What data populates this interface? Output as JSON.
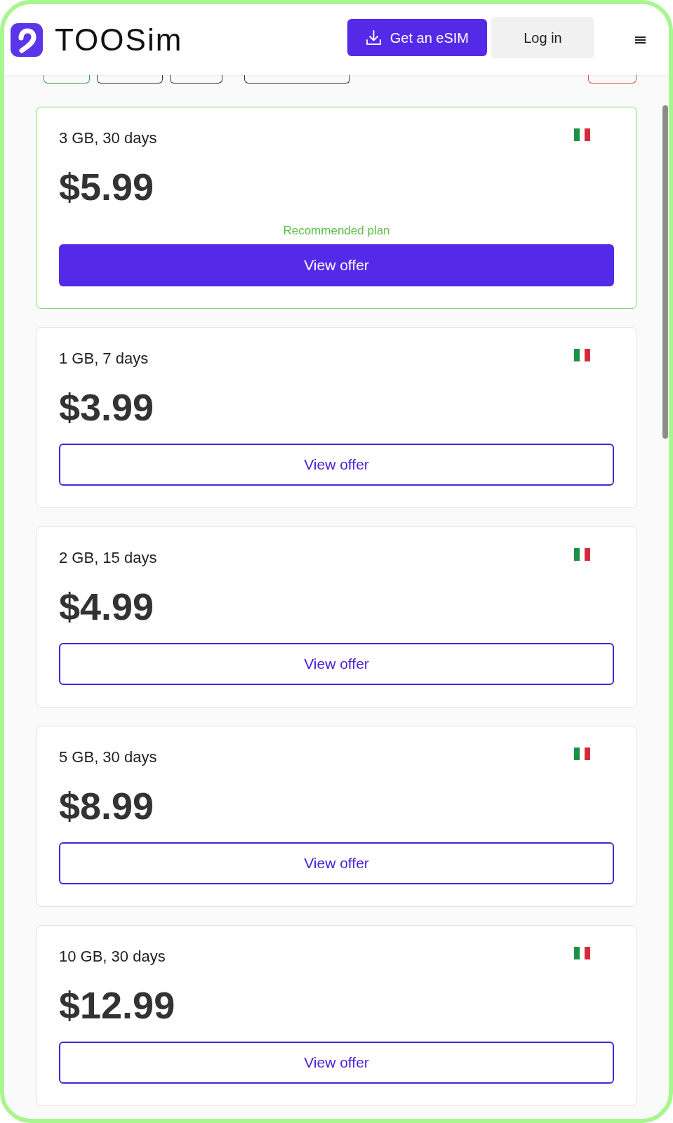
{
  "header": {
    "logo_text": "TOOSim",
    "actions": [
      {
        "kind": "primary",
        "label": "Get an eSIM"
      },
      {
        "kind": "secondary",
        "label": "Log in"
      }
    ]
  },
  "filter_chips": [
    {
      "color": "#3e9a4d"
    },
    {
      "color": "#3a3a3a"
    },
    {
      "color": "#3a3a3a"
    },
    {
      "color": "#3a3a3a"
    },
    {
      "color": "#d2544e"
    }
  ],
  "plans": [
    {
      "title": "3 GB, 30 days",
      "price": "$5.99",
      "recommended": true,
      "note": "Recommended plan",
      "action": "View offer"
    },
    {
      "title": "1 GB, 7 days",
      "price": "$3.99",
      "recommended": false,
      "action": "View offer"
    },
    {
      "title": "2 GB, 15 days",
      "price": "$4.99",
      "recommended": false,
      "action": "View offer"
    },
    {
      "title": "5 GB, 30 days",
      "price": "$8.99",
      "recommended": false,
      "action": "View offer"
    },
    {
      "title": "10 GB, 30 days",
      "price": "$12.99",
      "recommended": false,
      "action": "View offer"
    }
  ]
}
